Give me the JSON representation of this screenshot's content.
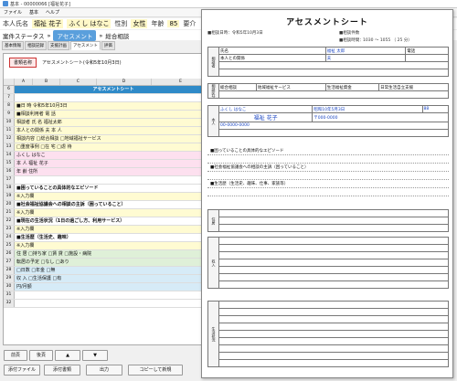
{
  "window": {
    "title": "基本 - 00000066 [福祉花子]"
  },
  "menu": [
    "ファイル",
    "基本",
    "ヘルプ"
  ],
  "info": {
    "name_label": "本人氏名",
    "name": "福祉 花子",
    "kana": "ふくし はなこ",
    "sex_label": "性別",
    "sex": "女性",
    "age_label": "年齢",
    "age": "85",
    "care_label": "要介"
  },
  "status": {
    "label": "案件ステータス",
    "s1": "アセスメント",
    "s2": "総合相談",
    "arrow": "»"
  },
  "tabs": [
    "基本情報",
    "相談記録",
    "支援計画",
    "アセスメント",
    "評価"
  ],
  "sheet": {
    "doc_label": "書類名称",
    "doc_value": "アセスメントシート(令和5年10月3日)",
    "cols": [
      "A",
      "B",
      "C",
      "D",
      "E"
    ],
    "rows": [
      {
        "n": "6",
        "t": "アセスメントシート",
        "c": "hdr-blue"
      },
      {
        "n": "7",
        "t": "",
        "c": ""
      },
      {
        "n": "8",
        "t": "■日 時   令和5年10月3日",
        "c": "hl-yellow"
      },
      {
        "n": "9",
        "t": "■相談利用者 電 話",
        "c": "hl-yellow"
      },
      {
        "n": "10",
        "t": "相談者  氏 名  福祉太郎",
        "c": "hl-yellow"
      },
      {
        "n": "11",
        "t": "本人との関係  夫  本 人",
        "c": "hl-yellow"
      },
      {
        "n": "12",
        "t": "相談内容 □総合相談 □地域福祉サービス",
        "c": "hl-yellow"
      },
      {
        "n": "13",
        "t": "□重度事例 □在 宅 □虐 待",
        "c": "hl-yellow"
      },
      {
        "n": "14",
        "t": "ふくし はなこ",
        "c": "hl-pink"
      },
      {
        "n": "15",
        "t": "本 人  福祉 花子",
        "c": "hl-pink"
      },
      {
        "n": "16",
        "t": "年 齢  住所",
        "c": "hl-pink"
      },
      {
        "n": "17",
        "t": "",
        "c": ""
      },
      {
        "n": "18",
        "t": "■困っていることの具体的なエピソード",
        "c": "section"
      },
      {
        "n": "19",
        "t": "※入力欄",
        "c": "hl-yellow"
      },
      {
        "n": "20",
        "t": "■社会福祉協議会への相談の主訴（困っていること）",
        "c": "section"
      },
      {
        "n": "21",
        "t": "※入力欄",
        "c": "hl-yellow"
      },
      {
        "n": "22",
        "t": "■現在の生活状況（1日の過ごし方、利用サービス）",
        "c": "section"
      },
      {
        "n": "23",
        "t": "※入力欄",
        "c": "hl-yellow"
      },
      {
        "n": "24",
        "t": "■生活歴（生活史、趣味）",
        "c": "section"
      },
      {
        "n": "25",
        "t": "※入力欄",
        "c": "hl-yellow"
      },
      {
        "n": "26",
        "t": "住 居 □持ち家 □賃 貸 □施設・病院",
        "c": "hl-green"
      },
      {
        "n": "27",
        "t": "転居の予定 □なし □あり",
        "c": "hl-green"
      },
      {
        "n": "28",
        "t": "□日数 □年金 □無",
        "c": "hl-blue"
      },
      {
        "n": "29",
        "t": "収 入 □生活保護 □有",
        "c": "hl-blue"
      },
      {
        "n": "30",
        "t": "円/月額",
        "c": "hl-blue"
      },
      {
        "n": "31",
        "t": "",
        "c": ""
      },
      {
        "n": "32",
        "t": "",
        "c": ""
      }
    ]
  },
  "buttons": {
    "prev": "前頁",
    "next": "後頁",
    "up": "▲",
    "down": "▼",
    "attach": "添付ファイル",
    "attach2": "添付書類",
    "print": "出力",
    "copy": "コピーして新規"
  },
  "doc": {
    "title": "アセスメントシート",
    "date_label": "■相談日時：令和5年10月3日",
    "count_label": "■相談件数",
    "time_label": "■相談時間：",
    "time_value": "1030  ～  1055  （  25 分）",
    "intake": {
      "label": "相談者",
      "name_label": "氏名",
      "name": "福祉 太郎",
      "rel": "本人との関係",
      "rel_value": "夫",
      "tel": "電話"
    },
    "kind_label": "相談区分",
    "kinds": [
      "総合相談",
      "地域福祉サービス",
      "生活福祉資金",
      "日常生活自立支援"
    ],
    "person": {
      "label": "本人",
      "kana": "ふくし はなこ",
      "name": "福祉 花子",
      "birth": "昭和10年5月3日",
      "age": "88",
      "addr": "〒000-0000",
      "tel": "00-0000-0000"
    },
    "sections": [
      "■困っていることの具体的なエピソード",
      "■社会福祉協議会への相談の主訴（困っていること）",
      "■生活歴（生活史、趣味、仕事、家族等）"
    ],
    "residence": "住居",
    "income": "収入",
    "life": "生活状況"
  }
}
